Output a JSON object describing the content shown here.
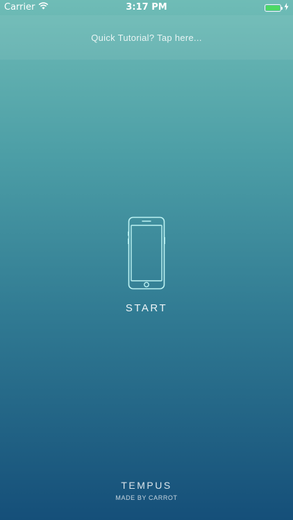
{
  "status_bar": {
    "carrier": "Carrier",
    "time": "3:17 PM",
    "battery_level": 1.0,
    "battery_color": "#4cd964",
    "icons": [
      "wifi-icon",
      "battery-icon",
      "charging-bolt-icon"
    ]
  },
  "banner": {
    "text": "Quick Tutorial? Tap here..."
  },
  "main": {
    "icon": "phone-outline-icon",
    "start_label": "START"
  },
  "footer": {
    "app_name": "TEMPUS",
    "credit": "MADE BY CARROT"
  },
  "colors": {
    "gradient_top": "#6fbcb6",
    "gradient_bottom": "#154f79",
    "icon_stroke": "#bdf3f3"
  }
}
